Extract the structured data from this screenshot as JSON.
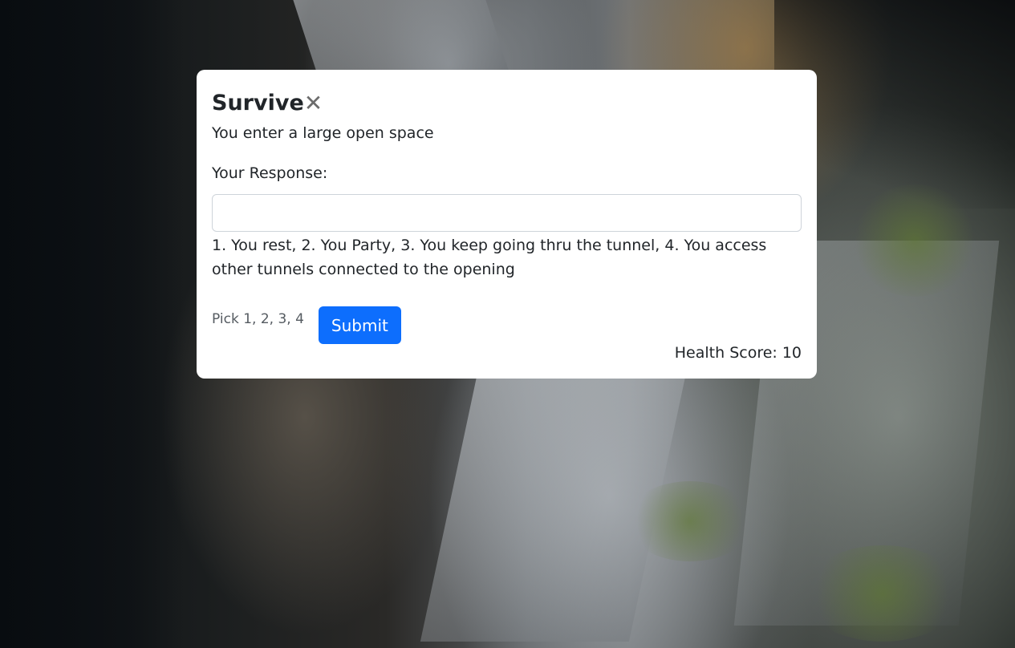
{
  "game": {
    "title": "Survive",
    "close_symbol": "✕",
    "scene": "You enter a large open space",
    "response_label": "Your Response:",
    "response_value": "",
    "options": "1. You rest, 2. You Party, 3. You keep going thru the tunnel, 4. You access other tunnels connected to the opening",
    "hint": "Pick 1, 2, 3, 4",
    "submit_label": "Submit",
    "health_label": "Health Score:",
    "health_value": "10"
  },
  "colors": {
    "accent": "#0d6efd",
    "modal_bg": "#ffffff",
    "text": "#212529"
  },
  "icons": {
    "close": "close-icon"
  }
}
